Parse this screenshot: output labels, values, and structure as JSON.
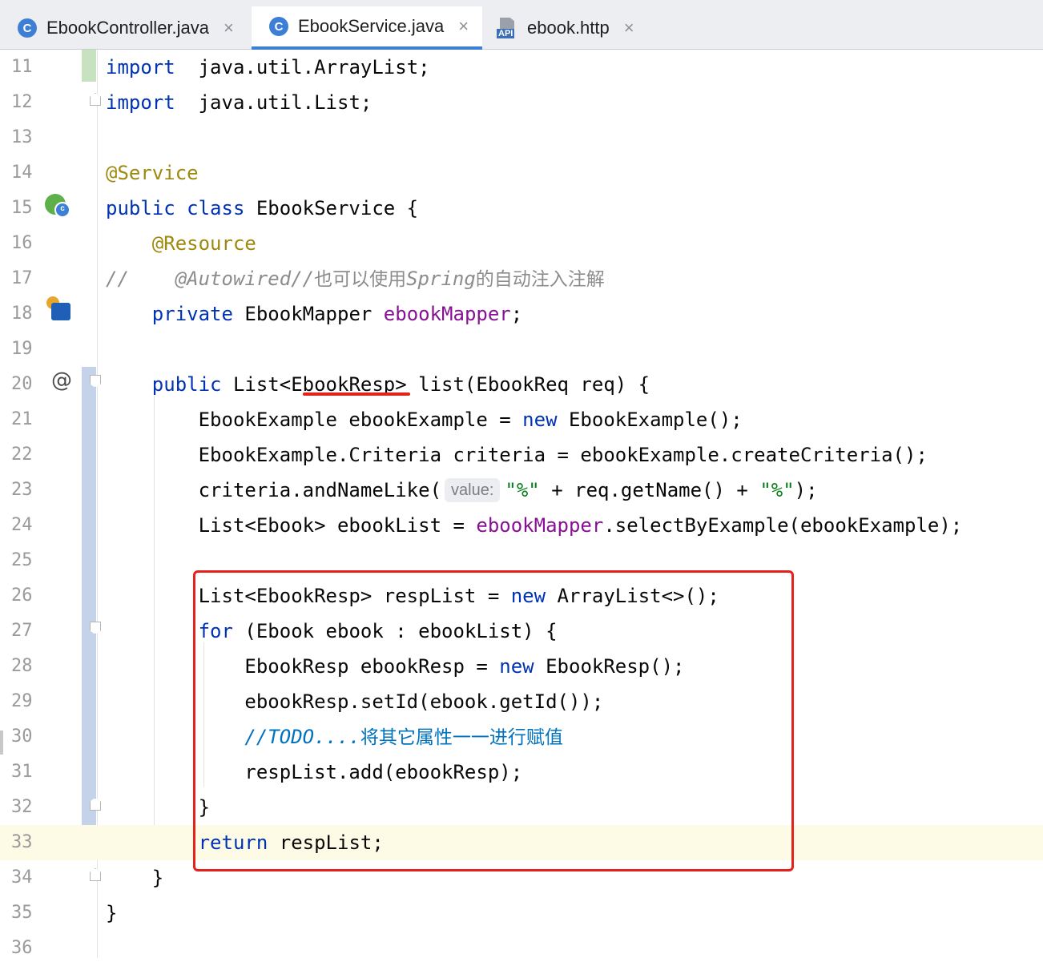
{
  "tabs": [
    {
      "label": "EbookController.java",
      "icon": "class-c-icon",
      "active": false
    },
    {
      "label": "EbookService.java",
      "icon": "class-c-icon",
      "active": true
    },
    {
      "label": "ebook.http",
      "icon": "api-file-icon",
      "active": false
    }
  ],
  "tab_close_glyph": "×",
  "api_icon_label": "API",
  "gutter_icons": {
    "line15": "spring-bean-icon",
    "line18": "inject-autowire-icon",
    "line20": "at-override-icon",
    "at_glyph": "@",
    "bean_sub": "c"
  },
  "current_line": 33,
  "inlay_hint": "value:",
  "lines": [
    {
      "n": "11",
      "tokens": [
        [
          "kw",
          "import"
        ],
        [
          "",
          "  java.util.ArrayList;"
        ]
      ]
    },
    {
      "n": "12",
      "tokens": [
        [
          "kw",
          "import"
        ],
        [
          "",
          "  java.util.List;"
        ]
      ]
    },
    {
      "n": "13",
      "tokens": []
    },
    {
      "n": "14",
      "tokens": [
        [
          "ann",
          "@Service"
        ]
      ]
    },
    {
      "n": "15",
      "tokens": [
        [
          "kw",
          "public class"
        ],
        [
          "",
          " EbookService {"
        ]
      ]
    },
    {
      "n": "16",
      "tokens": [
        [
          "",
          "    "
        ],
        [
          "ann",
          "@Resource"
        ]
      ]
    },
    {
      "n": "17",
      "tokens": [
        [
          "cm",
          "//    @Autowired//"
        ],
        [
          "cm-cn",
          "也可以使用"
        ],
        [
          "cm",
          "Spring"
        ],
        [
          "cm-cn",
          "的自动注入注解"
        ]
      ]
    },
    {
      "n": "18",
      "tokens": [
        [
          "",
          "    "
        ],
        [
          "kw",
          "private"
        ],
        [
          "",
          " EbookMapper "
        ],
        [
          "fld",
          "ebookMapper"
        ],
        [
          "",
          ";"
        ]
      ]
    },
    {
      "n": "19",
      "tokens": []
    },
    {
      "n": "20",
      "tokens": [
        [
          "",
          "    "
        ],
        [
          "kw",
          "public"
        ],
        [
          "",
          " List<EbookResp> list(EbookReq req) {"
        ]
      ]
    },
    {
      "n": "21",
      "tokens": [
        [
          "",
          "        EbookExample ebookExample = "
        ],
        [
          "kw",
          "new"
        ],
        [
          "",
          " EbookExample();"
        ]
      ]
    },
    {
      "n": "22",
      "tokens": [
        [
          "",
          "        EbookExample.Criteria criteria = ebookExample.createCriteria();"
        ]
      ]
    },
    {
      "n": "23",
      "tokens": [
        [
          "",
          "        criteria.andNameLike("
        ],
        [
          "hint",
          "value:"
        ],
        [
          "str",
          "\"%\""
        ],
        [
          "",
          " + req.getName() + "
        ],
        [
          "str",
          "\"%\""
        ],
        [
          "",
          ");"
        ]
      ]
    },
    {
      "n": "24",
      "tokens": [
        [
          "",
          "        List<Ebook> ebookList = "
        ],
        [
          "fld",
          "ebookMapper"
        ],
        [
          "",
          ".selectByExample(ebookExample);"
        ]
      ]
    },
    {
      "n": "25",
      "tokens": []
    },
    {
      "n": "26",
      "tokens": [
        [
          "",
          "        List<EbookResp> respList = "
        ],
        [
          "kw",
          "new"
        ],
        [
          "",
          " ArrayList<>();"
        ]
      ]
    },
    {
      "n": "27",
      "tokens": [
        [
          "",
          "        "
        ],
        [
          "kw",
          "for"
        ],
        [
          "",
          " (Ebook ebook : ebookList) {"
        ]
      ]
    },
    {
      "n": "28",
      "tokens": [
        [
          "",
          "            EbookResp ebookResp = "
        ],
        [
          "kw",
          "new"
        ],
        [
          "",
          " EbookResp();"
        ]
      ]
    },
    {
      "n": "29",
      "tokens": [
        [
          "",
          "            ebookResp.setId(ebook.getId());"
        ]
      ]
    },
    {
      "n": "30",
      "tokens": [
        [
          "",
          "            "
        ],
        [
          "todo",
          "//TODO...."
        ],
        [
          "todo-cn",
          "将其它属性一一进行赋值"
        ]
      ]
    },
    {
      "n": "31",
      "tokens": [
        [
          "",
          "            respList.add(ebookResp);"
        ]
      ]
    },
    {
      "n": "32",
      "tokens": [
        [
          "",
          "        }"
        ]
      ]
    },
    {
      "n": "33",
      "tokens": [
        [
          "",
          "        "
        ],
        [
          "kw",
          "return"
        ],
        [
          "",
          " respList;"
        ]
      ]
    },
    {
      "n": "34",
      "tokens": [
        [
          "",
          "    }"
        ]
      ]
    },
    {
      "n": "35",
      "tokens": [
        [
          "",
          "}"
        ]
      ]
    },
    {
      "n": "36",
      "tokens": []
    }
  ]
}
